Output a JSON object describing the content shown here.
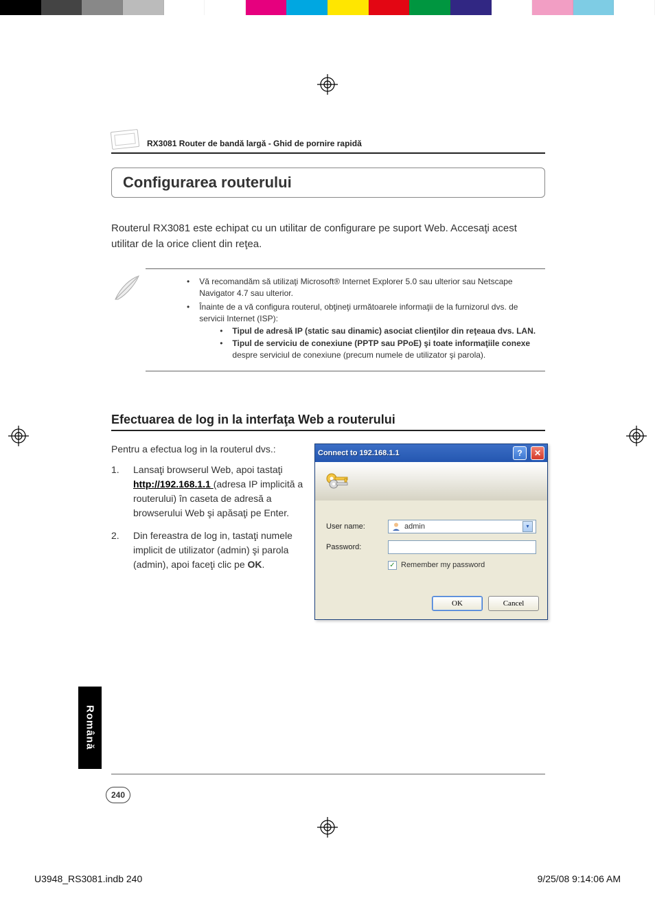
{
  "colorbar": [
    "#000",
    "#444",
    "#888",
    "#bbb",
    "#fff",
    "#fff",
    "#e6007e",
    "#00a7e1",
    "#ffe600",
    "#e30613",
    "#009640",
    "#312783",
    "#fff",
    "#f29ec4",
    "#7ecce4",
    "#fff"
  ],
  "header": {
    "doc_title": "RX3081 Router de bandă largă - Ghid de pornire rapidă"
  },
  "section_title": "Configurarea routerului",
  "intro_para": "Routerul RX3081 este echipat cu un utilitar de configurare pe suport Web. Accesaţi acest utilitar de la orice client din reţea.",
  "notes": {
    "n1": "Vă recomandăm să utilizaţi Microsoft®  Internet Explorer 5.0 sau ulterior sau Netscape Navigator 4.7 sau ulterior.",
    "n2": "Înainte de a vă configura routerul, obţineţi următoarele informaţii de la furnizorul dvs. de servicii Internet (ISP):",
    "s1": "Tipul de adresă IP (static sau dinamic) asociat clienţilor din reţeaua dvs. LAN.",
    "s2a": "Tipul de serviciu de conexiune (PPTP sau PPoE) şi toate informaţiile conexe",
    "s2b": " despre serviciul de conexiune (precum numele de utilizator şi parola)."
  },
  "h2": "Efectuarea de log in la interfaţa Web a routerului",
  "steps": {
    "intro": "Pentru a efectua log in la routerul dvs.:",
    "s1_lead": "Lansaţi browserul Web, apoi tastaţi ",
    "s1_url": "http://192.168.1.1 ",
    "s1_tail": "(adresa IP implicită a routerului) în caseta de adresă a browserului Web şi apăsaţi pe Enter.",
    "s2_lead": "Din fereastra de log in, tastaţi numele implicit de utilizator (admin) şi parola (admin), apoi faceţi clic pe ",
    "s2_ok": "OK",
    "s2_tail": "."
  },
  "dialog": {
    "title": "Connect to 192.168.1.1",
    "user_label": "User name:",
    "user_value": "admin",
    "pass_label": "Password:",
    "remember": "Remember my password",
    "ok": "OK",
    "cancel": "Cancel"
  },
  "lang_tab": "Română",
  "page_number": "240",
  "footer": {
    "left": "U3948_RS3081.indb   240",
    "right": "9/25/08   9:14:06 AM"
  }
}
